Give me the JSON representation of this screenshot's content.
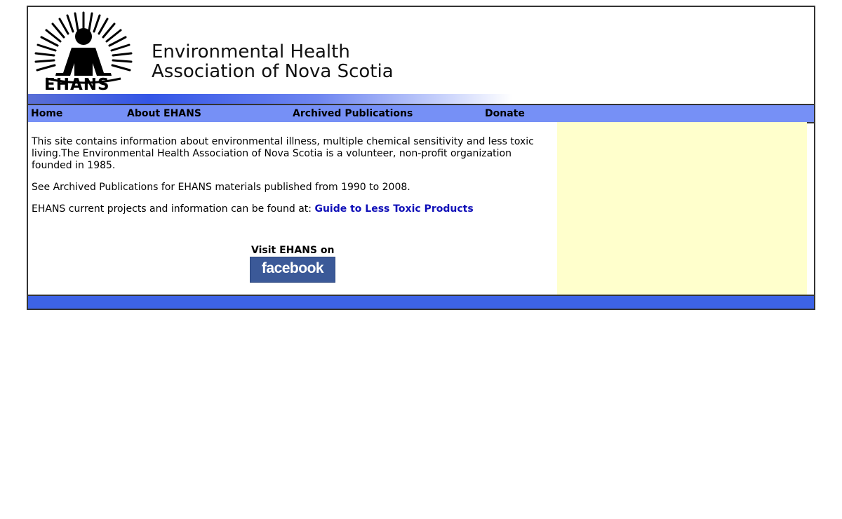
{
  "header": {
    "logo_text": "EHANS",
    "title_line1": "Environmental Health",
    "title_line2": "Association of Nova Scotia"
  },
  "nav": {
    "items": [
      {
        "label": "Home"
      },
      {
        "label": "About EHANS"
      },
      {
        "label": "Archived Publications"
      },
      {
        "label": "Donate"
      }
    ]
  },
  "content": {
    "intro": "This site contains information about environmental illness, multiple chemical sensitivity and less toxic living.The Environmental Health Association of Nova Scotia is a volunteer, non-profit organization founded in 1985.",
    "archive_note": "See Archived Publications for EHANS materials published from 1990 to 2008.",
    "projects_prefix": "EHANS current projects and information can be found at: ",
    "projects_link": "Guide to Less Toxic Products",
    "facebook_label": "Visit EHANS on",
    "facebook_badge": "facebook"
  },
  "colors": {
    "nav_bg": "#7690f6",
    "footer_bg": "#3d63e6",
    "sidebar_bg": "#ffffcc",
    "link": "#1010b8",
    "facebook_blue": "#3b5998"
  }
}
